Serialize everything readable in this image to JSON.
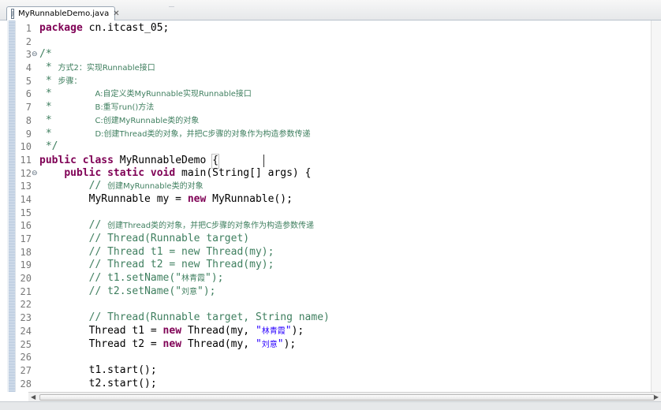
{
  "tab": {
    "title": "MyRunnableDemo.java",
    "close": "✕",
    "file_icon": "J"
  },
  "icons": {
    "file": "java-file-icon",
    "close": "close-icon",
    "fold": "fold-collapse-icon"
  },
  "colors": {
    "keyword": "#7f0055",
    "comment": "#3f7f5f",
    "string": "#2a00ff",
    "line_number": "#787878"
  },
  "lines": [
    {
      "n": "1",
      "fold": "",
      "segs": [
        {
          "c": "kw",
          "t": "package"
        },
        {
          "c": "",
          "t": " cn.itcast_05;"
        }
      ]
    },
    {
      "n": "2",
      "fold": "",
      "segs": []
    },
    {
      "n": "3",
      "fold": "⊖",
      "segs": [
        {
          "c": "cm",
          "t": "/*"
        }
      ]
    },
    {
      "n": "4",
      "fold": "",
      "segs": [
        {
          "c": "cm",
          "t": " * "
        },
        {
          "c": "cm cjk",
          "t": "方式2：实现Runnable接口"
        }
      ]
    },
    {
      "n": "5",
      "fold": "",
      "segs": [
        {
          "c": "cm",
          "t": " * "
        },
        {
          "c": "cm cjk",
          "t": "步骤："
        }
      ]
    },
    {
      "n": "6",
      "fold": "",
      "segs": [
        {
          "c": "cm",
          "t": " *       "
        },
        {
          "c": "cm cjk",
          "t": "A:自定义类MyRunnable实现Runnable接口"
        }
      ]
    },
    {
      "n": "7",
      "fold": "",
      "segs": [
        {
          "c": "cm",
          "t": " *       "
        },
        {
          "c": "cm cjk",
          "t": "B:重写run()方法"
        }
      ]
    },
    {
      "n": "8",
      "fold": "",
      "segs": [
        {
          "c": "cm",
          "t": " *       "
        },
        {
          "c": "cm cjk",
          "t": "C:创建MyRunnable类的对象"
        }
      ]
    },
    {
      "n": "9",
      "fold": "",
      "segs": [
        {
          "c": "cm",
          "t": " *       "
        },
        {
          "c": "cm cjk",
          "t": "D:创建Thread类的对象，并把C步骤的对象作为构造参数传递"
        }
      ]
    },
    {
      "n": "10",
      "fold": "",
      "segs": [
        {
          "c": "cm",
          "t": " */"
        }
      ]
    },
    {
      "n": "11",
      "fold": "",
      "segs": [
        {
          "c": "kw",
          "t": "public"
        },
        {
          "c": "",
          "t": " "
        },
        {
          "c": "kw",
          "t": "class"
        },
        {
          "c": "",
          "t": " MyRunnableDemo "
        },
        {
          "c": "caret-mark",
          "t": "{"
        }
      ]
    },
    {
      "n": "12",
      "fold": "⊖",
      "segs": [
        {
          "c": "",
          "t": "    "
        },
        {
          "c": "kw",
          "t": "public"
        },
        {
          "c": "",
          "t": " "
        },
        {
          "c": "kw",
          "t": "static"
        },
        {
          "c": "",
          "t": " "
        },
        {
          "c": "kw",
          "t": "void"
        },
        {
          "c": "",
          "t": " main(String[] args) {"
        }
      ]
    },
    {
      "n": "13",
      "fold": "",
      "segs": [
        {
          "c": "",
          "t": "        "
        },
        {
          "c": "cm",
          "t": "// "
        },
        {
          "c": "cm cjk",
          "t": "创建MyRunnable类的对象"
        }
      ]
    },
    {
      "n": "14",
      "fold": "",
      "segs": [
        {
          "c": "",
          "t": "        MyRunnable my = "
        },
        {
          "c": "kw",
          "t": "new"
        },
        {
          "c": "",
          "t": " MyRunnable();"
        }
      ]
    },
    {
      "n": "15",
      "fold": "",
      "segs": []
    },
    {
      "n": "16",
      "fold": "",
      "segs": [
        {
          "c": "",
          "t": "        "
        },
        {
          "c": "cm",
          "t": "// "
        },
        {
          "c": "cm cjk",
          "t": "创建Thread类的对象，并把C步骤的对象作为构造参数传递"
        }
      ]
    },
    {
      "n": "17",
      "fold": "",
      "segs": [
        {
          "c": "",
          "t": "        "
        },
        {
          "c": "cm",
          "t": "// Thread(Runnable target)"
        }
      ]
    },
    {
      "n": "18",
      "fold": "",
      "segs": [
        {
          "c": "",
          "t": "        "
        },
        {
          "c": "cm",
          "t": "// Thread t1 = new Thread(my);"
        }
      ]
    },
    {
      "n": "19",
      "fold": "",
      "segs": [
        {
          "c": "",
          "t": "        "
        },
        {
          "c": "cm",
          "t": "// Thread t2 = new Thread(my);"
        }
      ]
    },
    {
      "n": "20",
      "fold": "",
      "segs": [
        {
          "c": "",
          "t": "        "
        },
        {
          "c": "cm",
          "t": "// t1.setName(\""
        },
        {
          "c": "cm cjk",
          "t": "林青霞"
        },
        {
          "c": "cm",
          "t": "\");"
        }
      ]
    },
    {
      "n": "21",
      "fold": "",
      "segs": [
        {
          "c": "",
          "t": "        "
        },
        {
          "c": "cm",
          "t": "// t2.setName(\""
        },
        {
          "c": "cm cjk",
          "t": "刘意"
        },
        {
          "c": "cm",
          "t": "\");"
        }
      ]
    },
    {
      "n": "22",
      "fold": "",
      "segs": []
    },
    {
      "n": "23",
      "fold": "",
      "segs": [
        {
          "c": "",
          "t": "        "
        },
        {
          "c": "cm",
          "t": "// Thread(Runnable target, String name)"
        }
      ]
    },
    {
      "n": "24",
      "fold": "",
      "segs": [
        {
          "c": "",
          "t": "        Thread t1 = "
        },
        {
          "c": "kw",
          "t": "new"
        },
        {
          "c": "",
          "t": " Thread(my, "
        },
        {
          "c": "st",
          "t": "\""
        },
        {
          "c": "st cjk",
          "t": "林青霞"
        },
        {
          "c": "st",
          "t": "\""
        },
        {
          "c": "",
          "t": ");"
        }
      ]
    },
    {
      "n": "25",
      "fold": "",
      "segs": [
        {
          "c": "",
          "t": "        Thread t2 = "
        },
        {
          "c": "kw",
          "t": "new"
        },
        {
          "c": "",
          "t": " Thread(my, "
        },
        {
          "c": "st",
          "t": "\""
        },
        {
          "c": "st cjk",
          "t": "刘意"
        },
        {
          "c": "st",
          "t": "\""
        },
        {
          "c": "",
          "t": ");"
        }
      ]
    },
    {
      "n": "26",
      "fold": "",
      "segs": []
    },
    {
      "n": "27",
      "fold": "",
      "segs": [
        {
          "c": "",
          "t": "        t1.start();"
        }
      ]
    },
    {
      "n": "28",
      "fold": "",
      "segs": [
        {
          "c": "",
          "t": "        t2.start();"
        }
      ]
    }
  ]
}
